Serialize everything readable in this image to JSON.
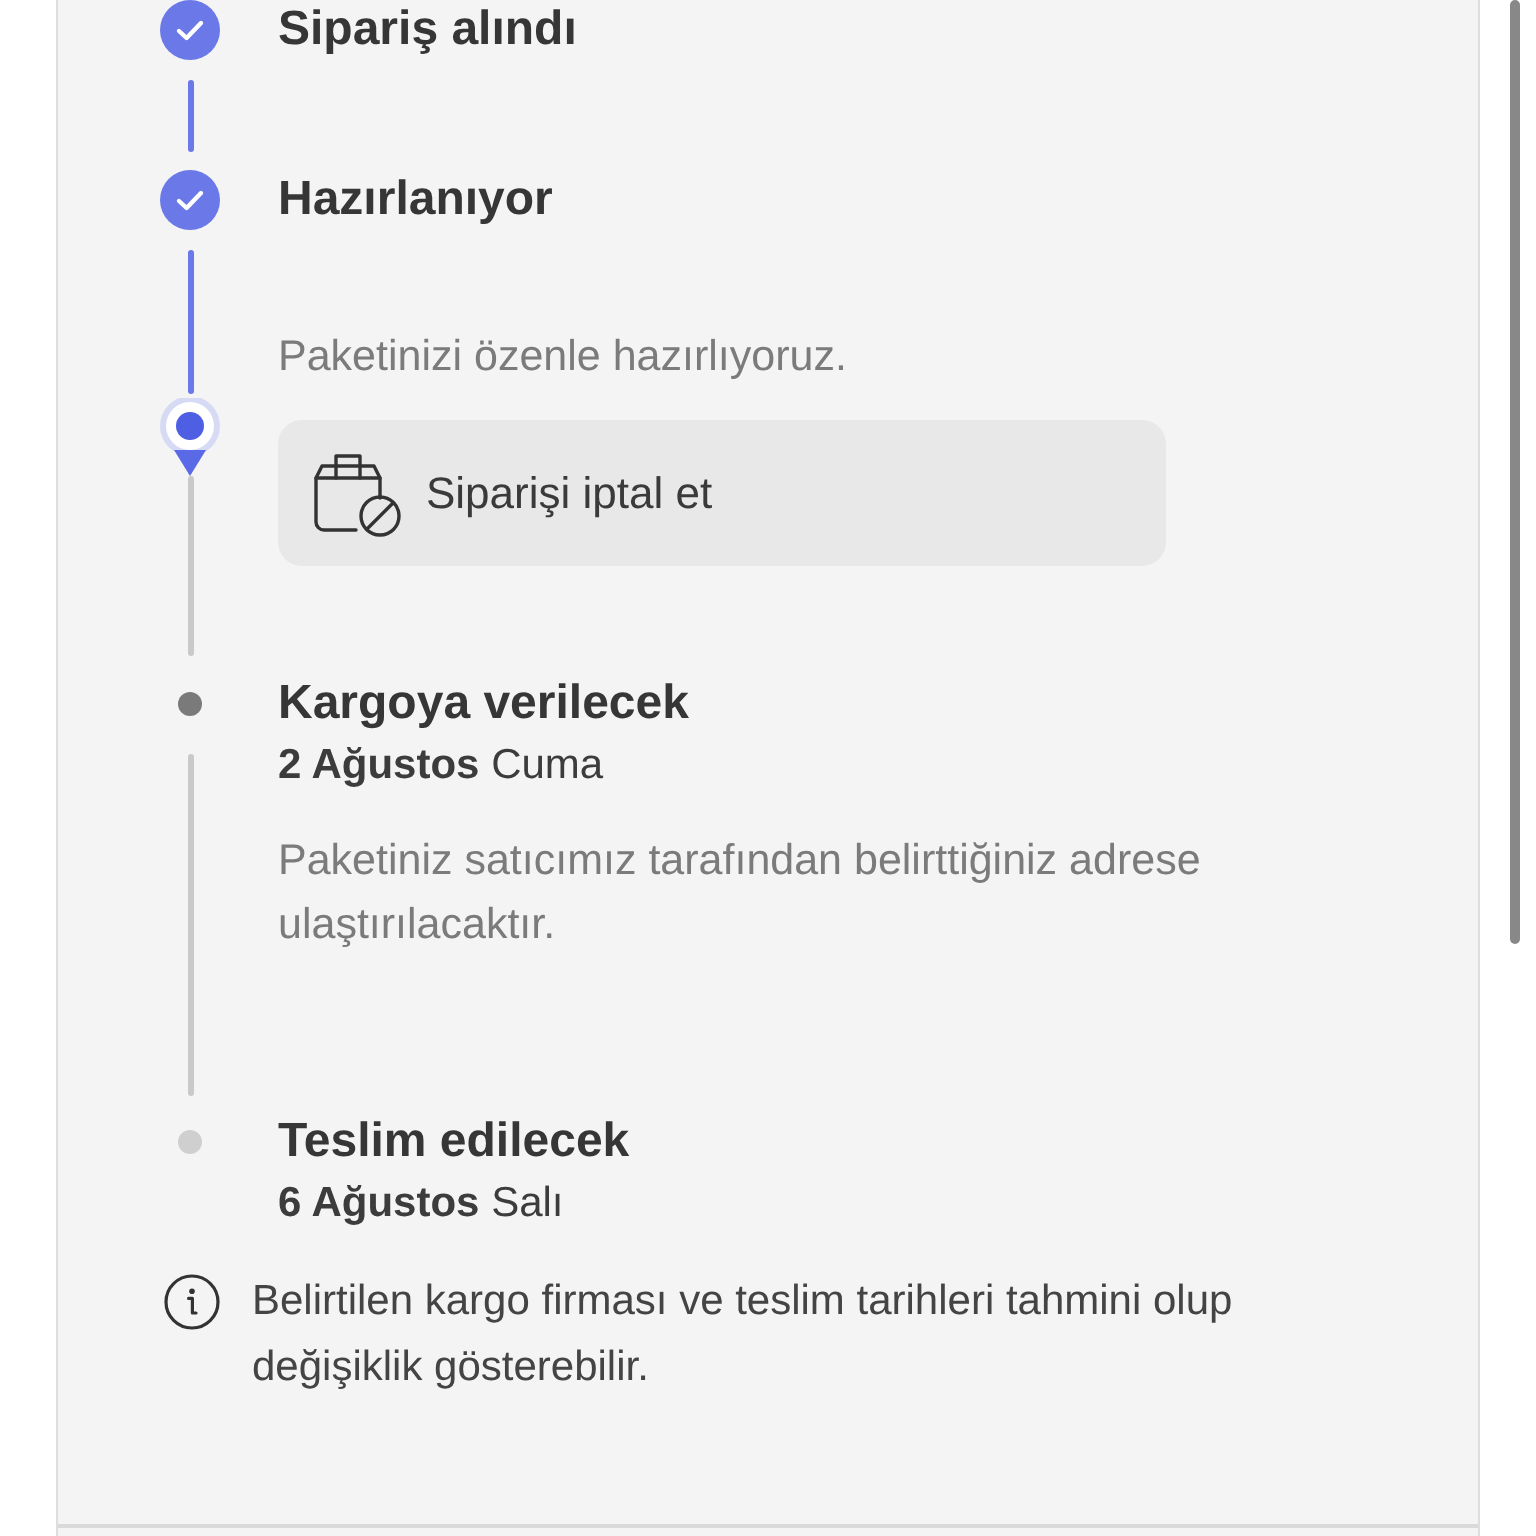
{
  "steps": [
    {
      "kind": "done",
      "title": "Sipariş alındı"
    },
    {
      "kind": "done",
      "title": "Hazırlanıyor",
      "description": "Paketinizi özenle hazırlıyoruz."
    },
    {
      "kind": "current",
      "action": {
        "label": "Siparişi iptal et"
      }
    },
    {
      "kind": "next",
      "title": "Kargoya verilecek",
      "date": "**2 Ağustos** Cuma",
      "description": "Paketiniz satıcımız tarafından belirttiğiniz adrese ulaştırılacaktır."
    },
    {
      "kind": "upcoming",
      "title": "Teslim edilecek",
      "date": "**6 Ağustos** Salı"
    }
  ],
  "note": "Belirtilen kargo firması ve teslim tarihleri tahmini olup değişiklik gösterebilir."
}
